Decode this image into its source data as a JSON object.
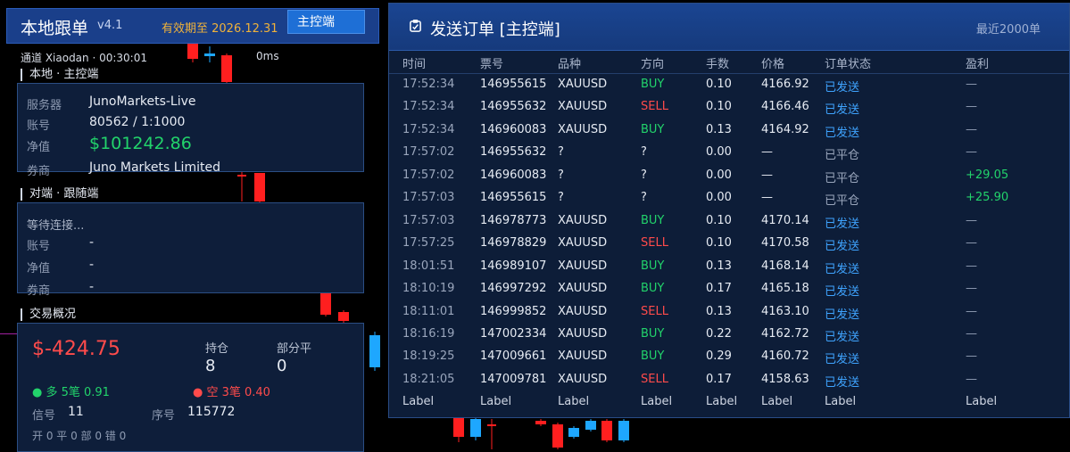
{
  "app": {
    "title": "本地跟单",
    "version": "v4.1",
    "expiry": "有效期至 2026.12.31",
    "role_button": "主控端"
  },
  "channel": {
    "line": "通道 Xiaodan  · 00:30:01",
    "latency": "0ms"
  },
  "local": {
    "section": "本地 · 主控端",
    "server_label": "服务器",
    "server": "JunoMarkets-Live",
    "account_label": "账号",
    "account": "80562  /  1:1000",
    "equity_label": "净值",
    "equity": "$101242.86",
    "broker_label": "券商",
    "broker": "Juno Markets Limited"
  },
  "remote": {
    "section": "对端 · 跟随端",
    "status": "等待连接...",
    "account_label": "账号",
    "account": "-",
    "equity_label": "净值",
    "equity": "-",
    "broker_label": "券商",
    "broker": "-"
  },
  "overview": {
    "section": "交易概况",
    "pnl": "$-424.75",
    "positions_label": "持仓",
    "positions": "8",
    "partial_label": "部分平",
    "partial": "0",
    "long": "● 多 5笔 0.91",
    "short": "● 空 3笔 0.40",
    "signal_label": "信号",
    "signal": "11",
    "seq_label": "序号",
    "seq": "115772",
    "counters": "开 0   平 0   部 0   错 0"
  },
  "orders": {
    "title": "发送订单 [主控端]",
    "recent": "最近2000单",
    "headers": [
      "时间",
      "票号",
      "品种",
      "方向",
      "手数",
      "价格",
      "订单状态",
      "盈利"
    ],
    "rows": [
      [
        "17:52:34",
        "146955615",
        "XAUUSD",
        "BUY",
        "0.10",
        "4166.92",
        "已发送",
        "—"
      ],
      [
        "17:52:34",
        "146955632",
        "XAUUSD",
        "SELL",
        "0.10",
        "4166.46",
        "已发送",
        "—"
      ],
      [
        "17:52:34",
        "146960083",
        "XAUUSD",
        "BUY",
        "0.13",
        "4164.92",
        "已发送",
        "—"
      ],
      [
        "17:57:02",
        "146955632",
        "?",
        "?",
        "0.00",
        "—",
        "已平仓",
        "—"
      ],
      [
        "17:57:02",
        "146960083",
        "?",
        "?",
        "0.00",
        "—",
        "已平仓",
        "+29.05"
      ],
      [
        "17:57:03",
        "146955615",
        "?",
        "?",
        "0.00",
        "—",
        "已平仓",
        "+25.90"
      ],
      [
        "17:57:03",
        "146978773",
        "XAUUSD",
        "BUY",
        "0.10",
        "4170.14",
        "已发送",
        "—"
      ],
      [
        "17:57:25",
        "146978829",
        "XAUUSD",
        "SELL",
        "0.10",
        "4170.58",
        "已发送",
        "—"
      ],
      [
        "18:01:51",
        "146989107",
        "XAUUSD",
        "BUY",
        "0.13",
        "4168.14",
        "已发送",
        "—"
      ],
      [
        "18:10:19",
        "146997292",
        "XAUUSD",
        "BUY",
        "0.17",
        "4165.18",
        "已发送",
        "—"
      ],
      [
        "18:11:01",
        "146999852",
        "XAUUSD",
        "SELL",
        "0.13",
        "4163.10",
        "已发送",
        "—"
      ],
      [
        "18:16:19",
        "147002334",
        "XAUUSD",
        "BUY",
        "0.22",
        "4162.72",
        "已发送",
        "—"
      ],
      [
        "18:19:25",
        "147009661",
        "XAUUSD",
        "BUY",
        "0.29",
        "4160.72",
        "已发送",
        "—"
      ],
      [
        "18:21:05",
        "147009781",
        "XAUUSD",
        "SELL",
        "0.17",
        "4158.63",
        "已发送",
        "—"
      ]
    ],
    "footer": [
      "Label",
      "Label",
      "Label",
      "Label",
      "Label",
      "Label",
      "Label",
      "Label"
    ]
  },
  "colors": {
    "buy": "#22d36b",
    "sell": "#ff4b4b",
    "sent": "#3fa4ff",
    "panel": "#0d1d38",
    "header": "#1a4592"
  }
}
